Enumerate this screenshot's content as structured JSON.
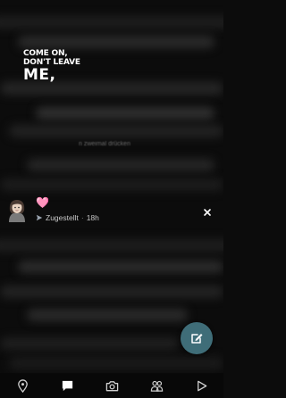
{
  "headline": {
    "line1": "COME ON,",
    "line2": "DON'T LEAVE",
    "line3": "ME,"
  },
  "background_text": "n zweimal drücken",
  "notification": {
    "emoji": "🩷",
    "status": "Zugestellt",
    "separator": "·",
    "time": "18h",
    "accent_color": "#9aa4b0"
  },
  "fab": {
    "icon": "edit-chat-icon",
    "color": "#3f6d78"
  },
  "bottom_nav": [
    {
      "name": "map",
      "icon": "map-pin-icon"
    },
    {
      "name": "chat",
      "icon": "chat-icon"
    },
    {
      "name": "camera",
      "icon": "camera-icon"
    },
    {
      "name": "stories",
      "icon": "friends-icon"
    },
    {
      "name": "spotlight",
      "icon": "play-icon"
    }
  ]
}
